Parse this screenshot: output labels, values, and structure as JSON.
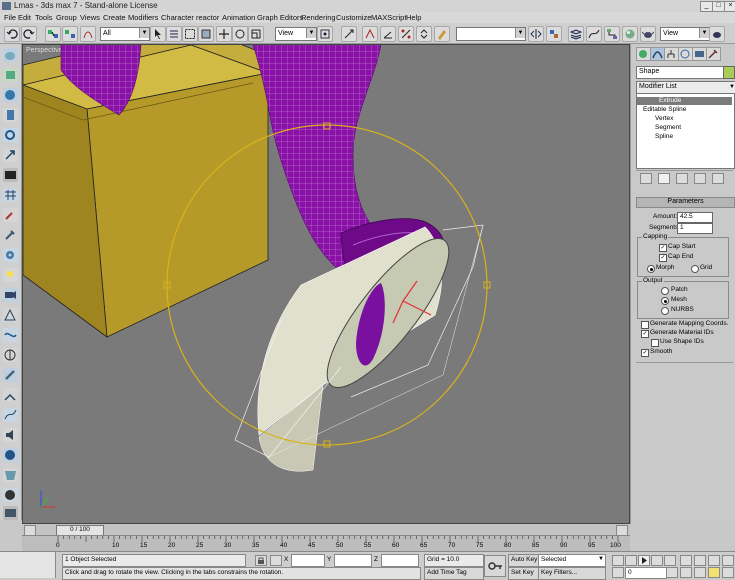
{
  "window": {
    "title": "Lmas - 3ds max 7 - Stand-alone License"
  },
  "menu": [
    "File",
    "Edit",
    "Tools",
    "Group",
    "Views",
    "Create",
    "Modifiers",
    "Character",
    "reactor",
    "Animation",
    "Graph Editors",
    "Rendering",
    "Customize",
    "MAXScript",
    "Help"
  ],
  "toolbar": {
    "selection_filter": "All",
    "ref_coord": "View",
    "named_sel": "",
    "view_dd": "View"
  },
  "viewport": {
    "label": "Perspective"
  },
  "command_panel": {
    "object_name": "Shape",
    "modifier_list": "Modifier List",
    "stack": [
      "Extrude",
      "Editable Spline",
      "Vertex",
      "Segment",
      "Spline"
    ],
    "rollout_title": "Parameters",
    "amount_label": "Amount:",
    "amount_value": "42.5",
    "segments_label": "Segments:",
    "segments_value": "1",
    "capping": {
      "title": "Capping",
      "cap_start": "Cap Start",
      "cap_end": "Cap End",
      "morph": "Morph",
      "grid": "Grid"
    },
    "output": {
      "title": "Output",
      "patch": "Patch",
      "mesh": "Mesh",
      "nurbs": "NURBS"
    },
    "gen_mapping": "Generate Mapping Coords.",
    "gen_material": "Generate Material IDs",
    "use_shape_ids": "Use Shape IDs",
    "smooth": "Smooth"
  },
  "time": {
    "slider": "0 / 100",
    "ticks": [
      "0",
      "10",
      "15",
      "20",
      "25",
      "30",
      "35",
      "40",
      "45",
      "50",
      "55",
      "60",
      "65",
      "70",
      "75",
      "80",
      "85",
      "90",
      "95",
      "100"
    ]
  },
  "status": {
    "selection": "1 Object Selected",
    "prompt": "Click and drag to rotate the view. Clicking in the tabs constrains the rotation.",
    "x_label": "X",
    "y_label": "Y",
    "z_label": "Z",
    "grid": "Grid = 10.0",
    "add_time_tag": "Add Time Tag",
    "auto_key": "Auto Key",
    "auto_key_mode": "Selected",
    "set_key": "Set Key",
    "key_filters": "Key Filters...",
    "frame": "0"
  },
  "colors": {
    "viewport_bg": "#7a7a7a",
    "purple": "#8a10a8",
    "box": "#c4ad3c",
    "gizmo": "#d9b31a"
  }
}
